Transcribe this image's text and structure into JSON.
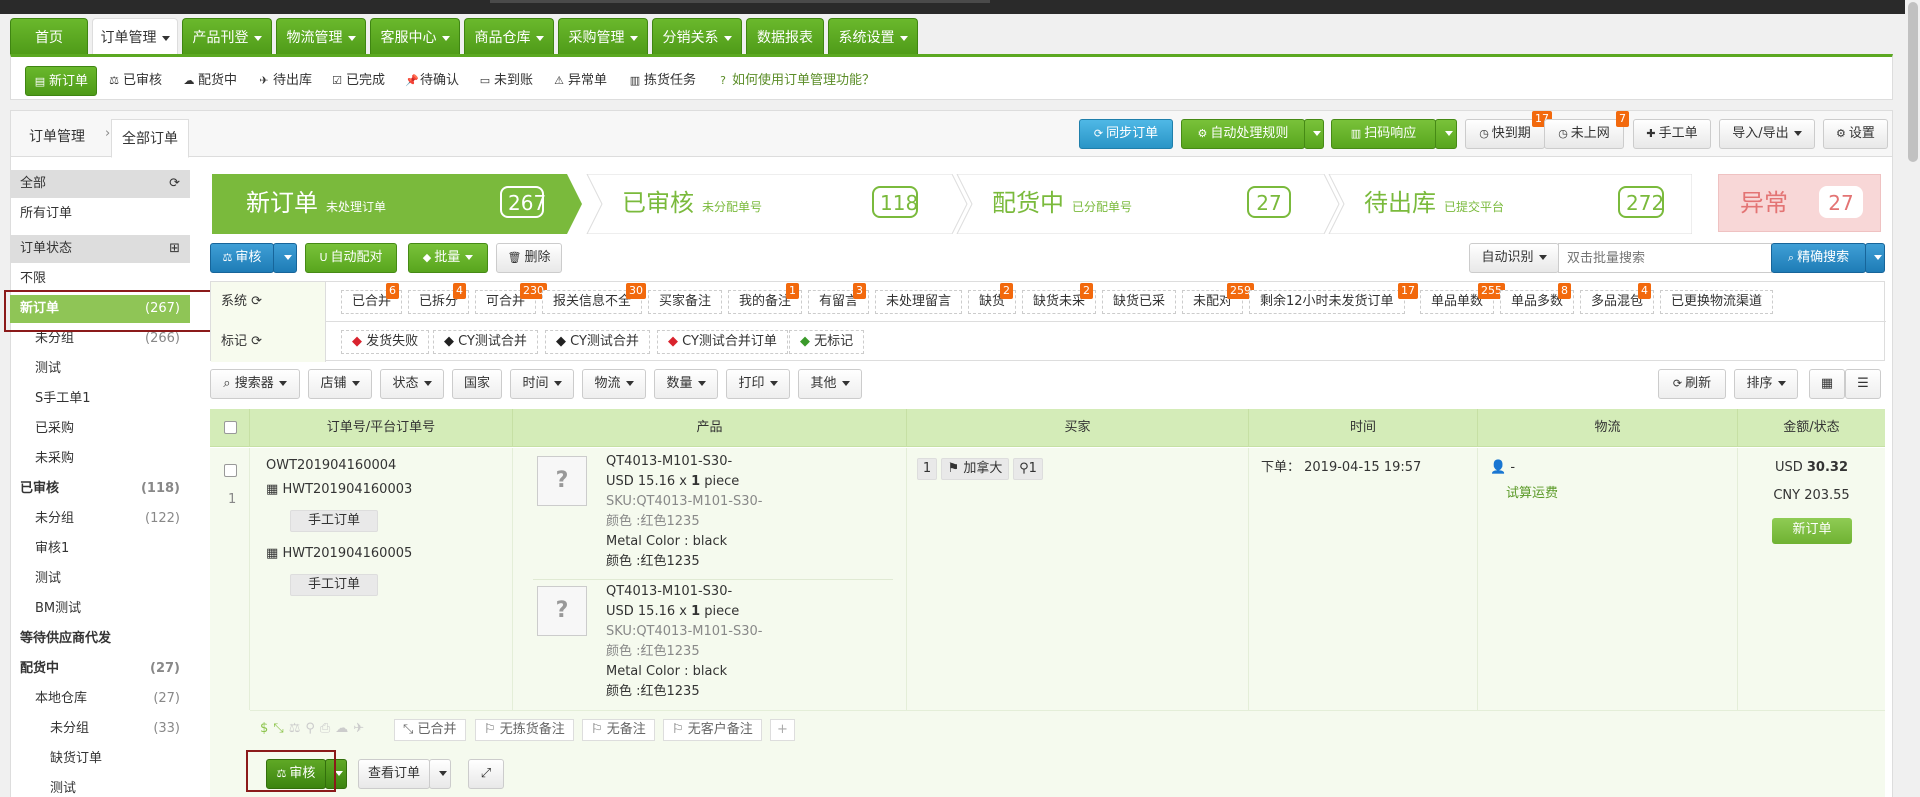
{
  "nav": {
    "items": [
      {
        "label": "首页",
        "dropdown": false
      },
      {
        "label": "订单管理",
        "dropdown": true,
        "active": true
      },
      {
        "label": "产品刊登",
        "dropdown": true
      },
      {
        "label": "物流管理",
        "dropdown": true
      },
      {
        "label": "客服中心",
        "dropdown": true
      },
      {
        "label": "商品仓库",
        "dropdown": true
      },
      {
        "label": "采购管理",
        "dropdown": true
      },
      {
        "label": "分销关系",
        "dropdown": true
      },
      {
        "label": "数据报表",
        "dropdown": true
      },
      {
        "label": "系统设置",
        "dropdown": true
      }
    ]
  },
  "subnav": {
    "items": [
      "新订单",
      "已审核",
      "配货中",
      "待出库",
      "已完成",
      "待确认",
      "未到账",
      "异常单",
      "拣货任务"
    ],
    "help": "如何使用订单管理功能？"
  },
  "breadcrumb": {
    "root": "订单管理",
    "current": "全部订单"
  },
  "toolbar": {
    "sync": "同步订单",
    "auto_rule": "自动处理规则",
    "scan": "扫码响应",
    "expiring": "快到期",
    "expiring_badge": "17",
    "not_online": "未上网",
    "not_online_badge": "7",
    "manual": "手工单",
    "import_export": "导入/导出",
    "settings": "设置"
  },
  "sidebar": {
    "all_header": "全部",
    "all_orders": "所有订单",
    "status_header": "订单状态",
    "rows": [
      {
        "label": "不限",
        "count": "",
        "level": 0
      },
      {
        "label": "新订单",
        "count": "(267)",
        "level": 0,
        "active": true
      },
      {
        "label": "未分组",
        "count": "(266)",
        "level": 1
      },
      {
        "label": "测试",
        "count": "",
        "level": 1
      },
      {
        "label": "S手工单1",
        "count": "",
        "level": 1
      },
      {
        "label": "已采购",
        "count": "",
        "level": 1
      },
      {
        "label": "未采购",
        "count": "",
        "level": 1
      },
      {
        "label": "已审核",
        "count": "(118)",
        "level": 0,
        "bold": true
      },
      {
        "label": "未分组",
        "count": "(122)",
        "level": 1
      },
      {
        "label": "审核1",
        "count": "",
        "level": 1
      },
      {
        "label": "测试",
        "count": "",
        "level": 1
      },
      {
        "label": "BM测试",
        "count": "",
        "level": 1
      },
      {
        "label": "等待供应商代发",
        "count": "",
        "level": 0,
        "bold": true
      },
      {
        "label": "配货中",
        "count": "(27)",
        "level": 0,
        "bold": true
      },
      {
        "label": "本地仓库",
        "count": "(27)",
        "level": 1
      },
      {
        "label": "未分组",
        "count": "(33)",
        "level": 2
      },
      {
        "label": "缺货订单",
        "count": "",
        "level": 2
      },
      {
        "label": "测试",
        "count": "",
        "level": 2
      }
    ]
  },
  "stages": [
    {
      "title": "新订单",
      "sub": "未处理订单",
      "count": "267"
    },
    {
      "title": "已审核",
      "sub": "未分配单号",
      "count": "118"
    },
    {
      "title": "配货中",
      "sub": "已分配单号",
      "count": "27"
    },
    {
      "title": "待出库",
      "sub": "已提交平台",
      "count": "272"
    },
    {
      "title": "异常",
      "sub": "",
      "count": "27"
    }
  ],
  "actions": {
    "audit": "审核",
    "auto_match": "自动配对",
    "batch": "批量",
    "delete": "删除",
    "auto_detect": "自动识别",
    "search_placeholder": "双击批量搜索",
    "precise_search": "精确搜索"
  },
  "filters": {
    "system_label": "系统",
    "mark_label": "标记",
    "system_tags": [
      {
        "label": "已合并",
        "badge": "6"
      },
      {
        "label": "已拆分",
        "badge": "4"
      },
      {
        "label": "可合并",
        "badge": "230"
      },
      {
        "label": "报关信息不全",
        "badge": "30"
      },
      {
        "label": "买家备注",
        "badge": ""
      },
      {
        "label": "我的备注",
        "badge": "1"
      },
      {
        "label": "有留言",
        "badge": "3"
      },
      {
        "label": "未处理留言",
        "badge": ""
      },
      {
        "label": "缺货",
        "badge": "2"
      },
      {
        "label": "缺货未采",
        "badge": "2"
      },
      {
        "label": "缺货已采",
        "badge": ""
      },
      {
        "label": "未配对",
        "badge": "259"
      },
      {
        "label": "剩余12小时未发货订单",
        "badge": "17"
      },
      {
        "label": "单品单数",
        "badge": "255"
      },
      {
        "label": "单品多数",
        "badge": "8"
      },
      {
        "label": "多品混包",
        "badge": "4"
      },
      {
        "label": "已更换物流渠道",
        "badge": ""
      }
    ],
    "mark_tags": [
      {
        "label": "发货失败",
        "color": "#d9232e"
      },
      {
        "label": "CY测试合并",
        "color": "#222222"
      },
      {
        "label": "CY测试合并",
        "color": "#222222"
      },
      {
        "label": "CY测试合并订单",
        "color": "#d9232e"
      },
      {
        "label": "无标记",
        "color": "#3a9a2a"
      }
    ]
  },
  "listbar": {
    "items": [
      "搜索器",
      "店铺",
      "状态",
      "国家",
      "时间",
      "物流",
      "数量",
      "打印",
      "其他"
    ],
    "refresh": "刷新",
    "sort": "排序"
  },
  "table": {
    "headers": [
      "订单号/平台订单号",
      "产品",
      "买家",
      "时间",
      "物流",
      "金额/状态"
    ]
  },
  "order": {
    "index": "1",
    "order_no": "OWT201904160004",
    "platform_orders": [
      {
        "no": "HWT201904160003",
        "type": "手工订单"
      },
      {
        "no": "HWT201904160005",
        "type": "手工订单"
      }
    ],
    "products": [
      {
        "name": "QT4013-M101-S30-",
        "price": "USD 15.16 x",
        "qty": "1",
        "unit": "piece",
        "sku": "SKU:QT4013-M101-S30-",
        "attr1": "颜色 :红色1235",
        "attr2": "Metal Color : black",
        "attr3": "颜色 :红色1235"
      },
      {
        "name": "QT4013-M101-S30-",
        "price": "USD 15.16 x",
        "qty": "1",
        "unit": "piece",
        "sku": "SKU:QT4013-M101-S30-",
        "attr1": "颜色 :红色1235",
        "attr2": "Metal Color : black",
        "attr3": "颜色 :红色1235"
      }
    ],
    "buyer_qty": "1",
    "buyer_country": "加拿大",
    "buyer_loc": "1",
    "time": "下单： 2019-04-15 19:57",
    "logistics_name": "-",
    "logistics_calc": "试算运费",
    "amount_usd_label": "USD",
    "amount_usd": "30.32",
    "amount_cny": "CNY 203.55",
    "status": "新订单",
    "footer_tags": [
      "已合并",
      "无拣货备注",
      "无备注",
      "无客户备注"
    ],
    "audit": "审核",
    "view": "查看订单"
  },
  "colors": {
    "brand_green": "#5ba821",
    "accent_blue": "#2a95c6",
    "badge_orange": "#f2690d",
    "highlight": "#8b1a1a"
  }
}
